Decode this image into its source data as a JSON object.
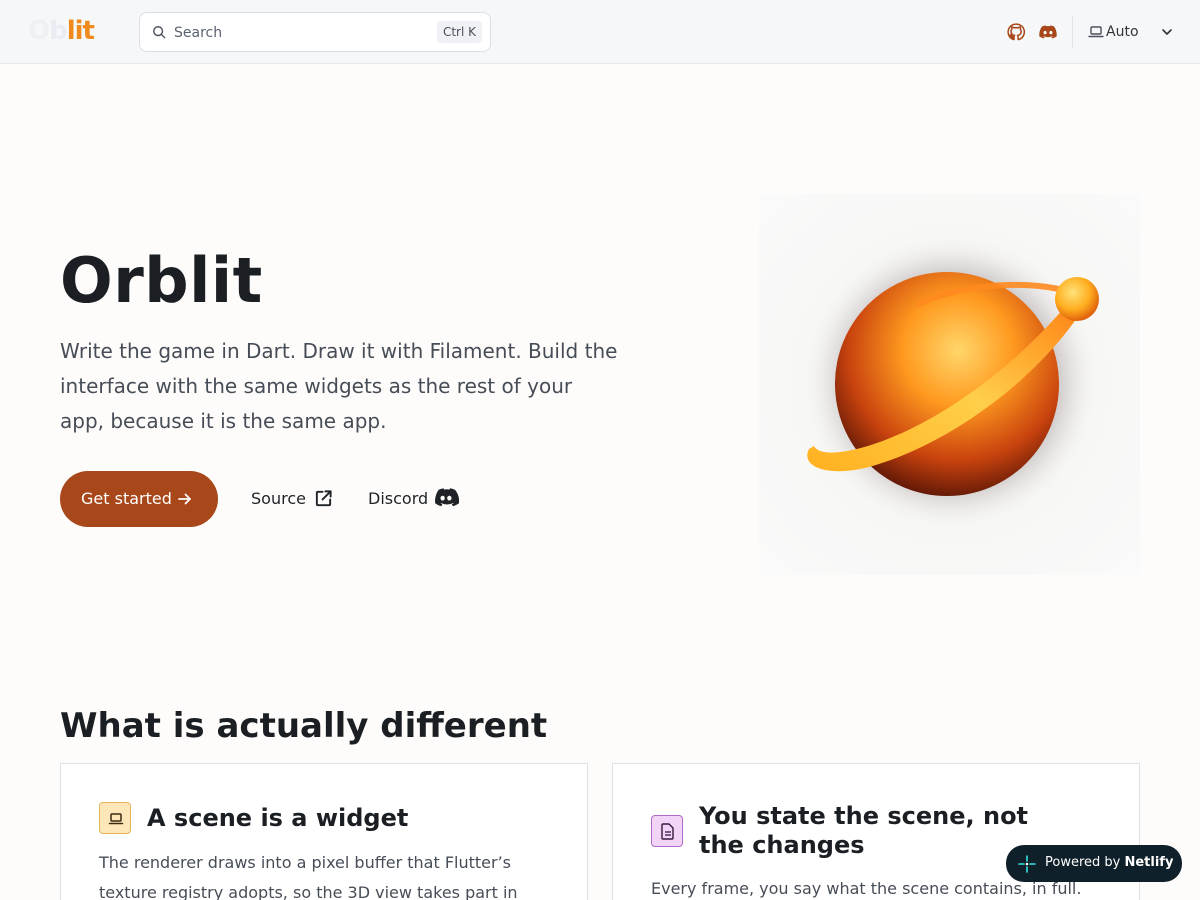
{
  "header": {
    "logo_parts": {
      "o": "O",
      "b": "b",
      "lit": "lit"
    },
    "search_placeholder": "Search",
    "search_shortcut": "Ctrl K",
    "theme_label": "Auto",
    "icons": [
      "github-icon",
      "discord-icon",
      "laptop-icon",
      "chevron-down-icon"
    ]
  },
  "hero": {
    "title": "Orblit",
    "subtitle": "Write the game in Dart. Draw it with Filament. Build the interface with the same widgets as the rest of your app, because it is the same app.",
    "primary_button": "Get started",
    "source_link": "Source",
    "discord_link": "Discord"
  },
  "section": {
    "title": "What is actually different",
    "cards": [
      {
        "title": "A scene is a widget",
        "body": "The renderer draws into a pixel buffer that Flutter’s texture registry adopts, so the 3D view takes part in layout. A panel",
        "icon": "laptop-icon"
      },
      {
        "title": "You state the scene, not the changes",
        "body": "Every frame, you say what the scene contains, in full. The",
        "icon": "document-icon"
      }
    ]
  },
  "badge": {
    "prefix": "Powered by ",
    "brand": "Netlify"
  },
  "colors": {
    "accent": "#a8481a",
    "logo_orange": "#f08a1c",
    "badge_bg": "#10202a"
  }
}
